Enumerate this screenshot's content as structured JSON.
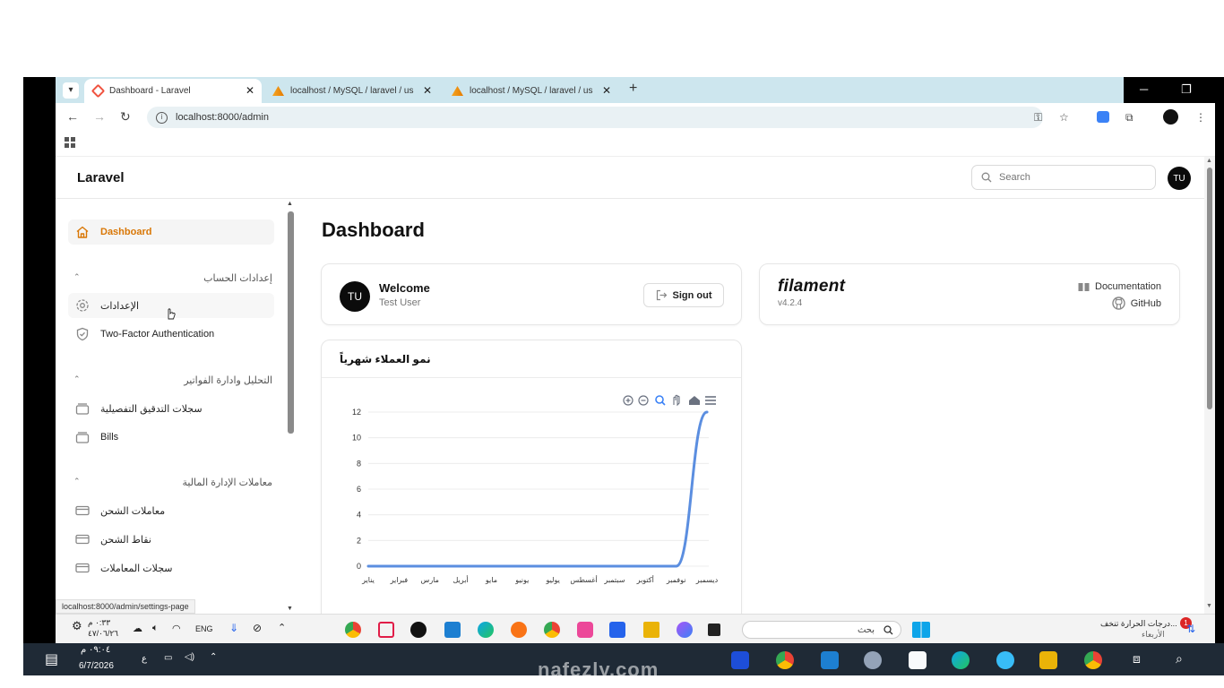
{
  "browser": {
    "tabs": [
      {
        "title": "Dashboard - Laravel",
        "active": true,
        "favicon": "laravel-icon"
      },
      {
        "title": "localhost / MySQL / laravel / us",
        "active": false,
        "favicon": "phpmyadmin-icon"
      },
      {
        "title": "localhost / MySQL / laravel / us",
        "active": false,
        "favicon": "phpmyadmin-icon"
      }
    ],
    "url": "localhost:8000/admin",
    "status_url": "localhost:8000/admin/settings-page"
  },
  "app": {
    "brand": "Laravel",
    "search_placeholder": "Search",
    "avatar_initials": "TU"
  },
  "sidebar": {
    "dashboard": "Dashboard",
    "groups": [
      {
        "label": "إعدادات الحساب",
        "items": [
          {
            "label": "الإعدادات",
            "icon": "gear-icon"
          },
          {
            "label": "Two-Factor Authentication",
            "icon": "shield-icon"
          }
        ]
      },
      {
        "label": "التحليل وادارة الفواتير",
        "items": [
          {
            "label": "سجلات التدقيق التفصيلية",
            "icon": "stack-icon"
          },
          {
            "label": "Bills",
            "icon": "stack-icon"
          }
        ]
      },
      {
        "label": "معاملات الإدارة المالية",
        "items": [
          {
            "label": "معاملات الشحن",
            "icon": "card-icon"
          },
          {
            "label": "نقاط الشحن",
            "icon": "card-icon"
          },
          {
            "label": "سجلات المعاملات",
            "icon": "card-icon"
          }
        ]
      }
    ]
  },
  "main": {
    "title": "Dashboard",
    "welcome": {
      "heading": "Welcome",
      "user": "Test User",
      "avatar": "TU",
      "signout_label": "Sign out"
    },
    "filament": {
      "logo": "filament",
      "version": "v4.2.4",
      "docs_label": "Documentation",
      "github_label": "GitHub"
    },
    "chart_card_title": "نمو العملاء شهرياً"
  },
  "chart_data": {
    "type": "line",
    "categories": [
      "يناير",
      "فبراير",
      "مارس",
      "أبريل",
      "مايو",
      "يونيو",
      "يوليو",
      "أغسطس",
      "سبتمبر",
      "أكتوبر",
      "نوفمبر",
      "ديسمبر"
    ],
    "values": [
      0,
      0,
      0,
      0,
      0,
      0,
      0,
      0,
      0,
      0,
      0,
      12
    ],
    "ylim": [
      0,
      12
    ],
    "yticks": [
      0,
      2,
      4,
      6,
      8,
      10,
      12
    ],
    "title": "",
    "xlabel": "",
    "ylabel": "",
    "grid": true,
    "smooth": true,
    "colors": {
      "line": "#5b8ee0",
      "grid": "#ececec"
    }
  },
  "taskbar_top": {
    "time": "٠:٣٣ م",
    "date": "٤٧/٠٦/٢٦",
    "time2": "٠٩:٠٤ م",
    "lang": "ENG",
    "search_placeholder": "بحث",
    "weather": "درجات الحرارة تنخف...",
    "weather_sub": "الأربعاء",
    "badge": "1"
  },
  "taskbar_bottom": {
    "date": "6/7/2026",
    "lang": "ع"
  },
  "watermark": "nafezly.com"
}
